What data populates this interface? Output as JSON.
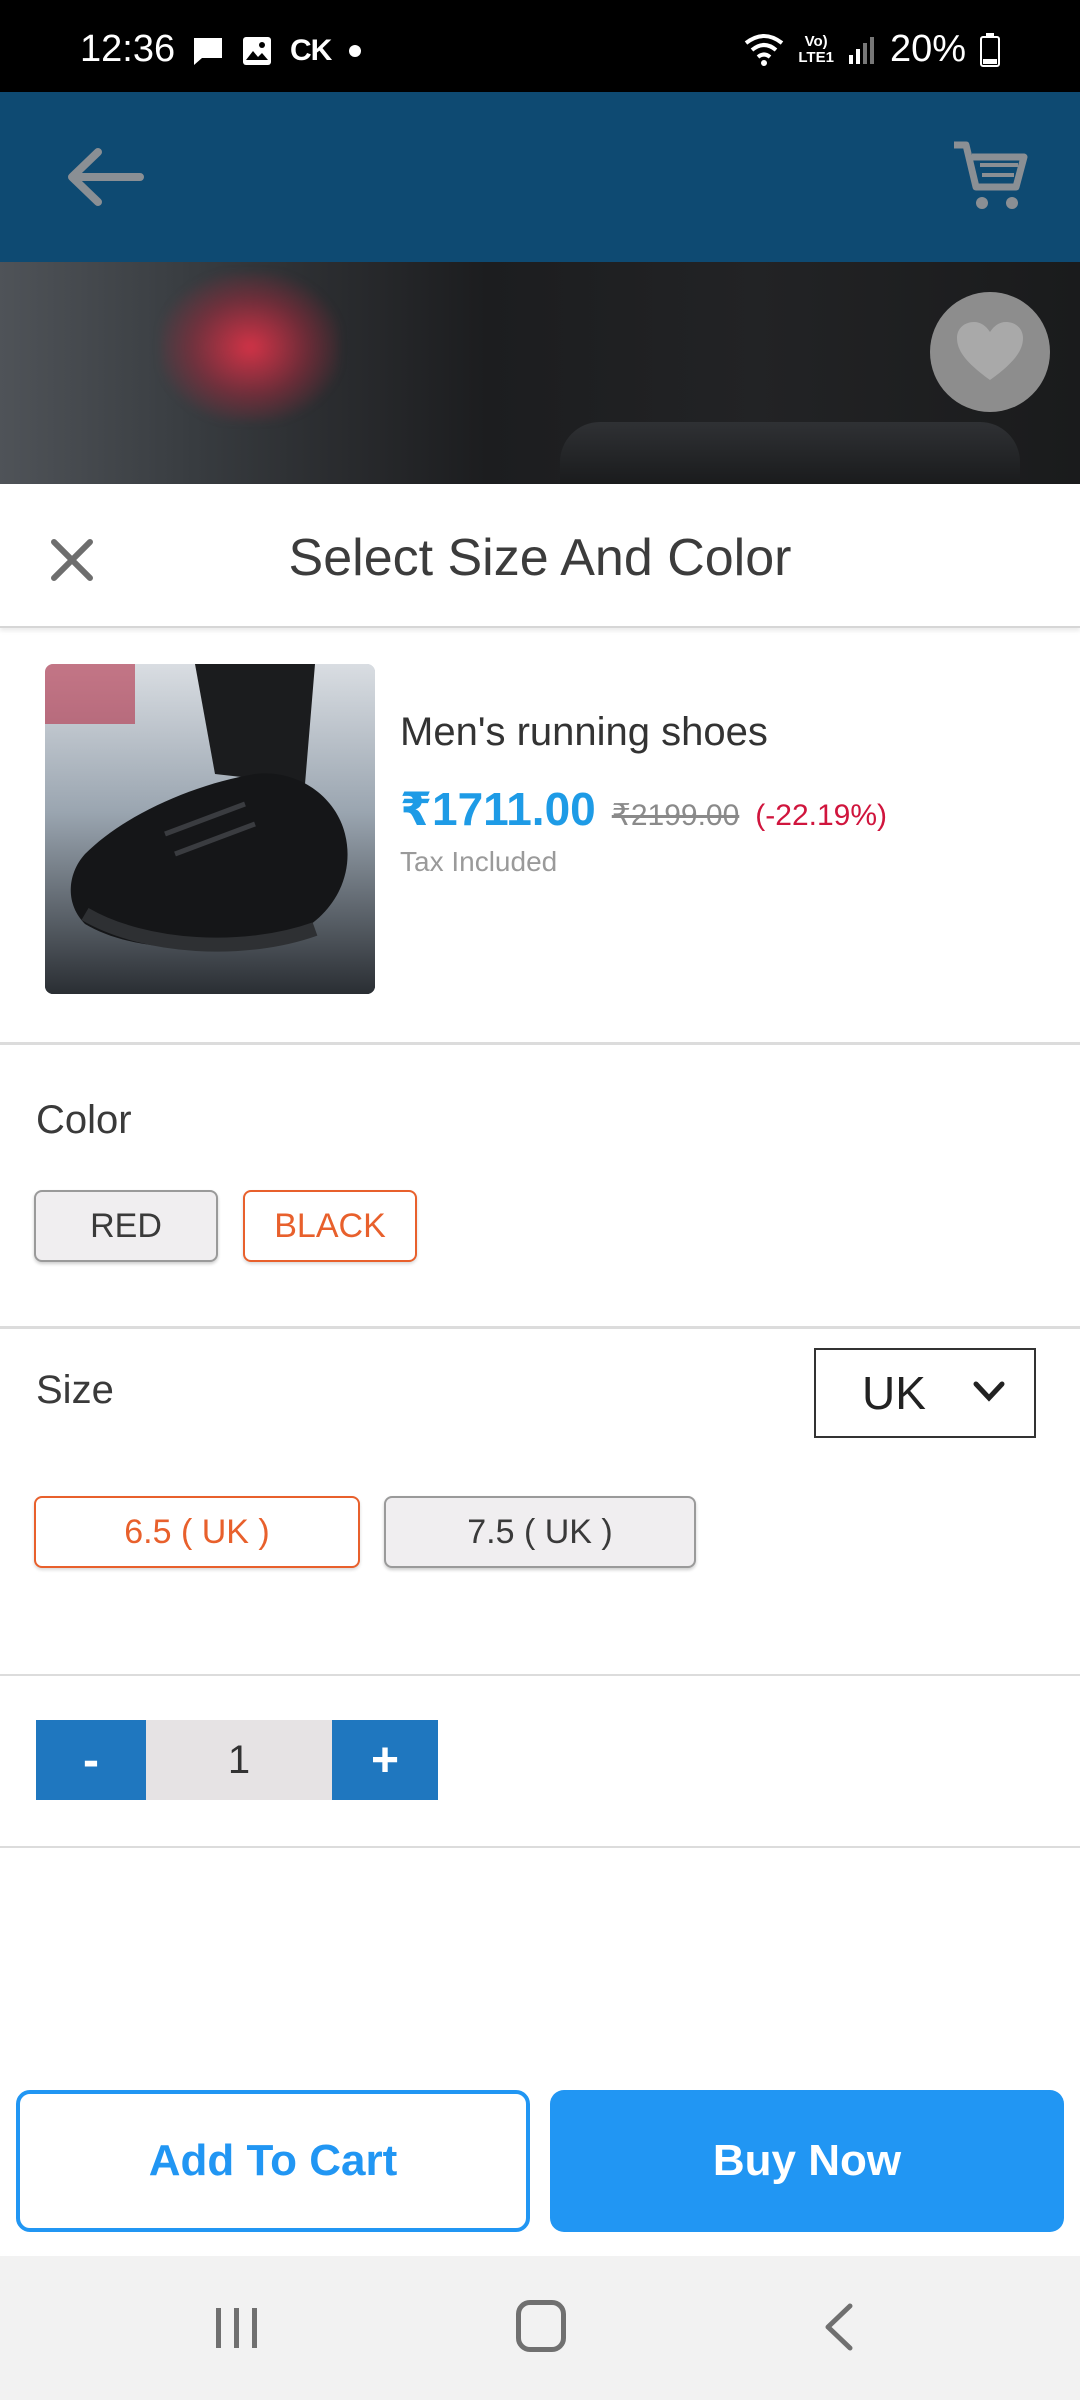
{
  "status_bar": {
    "time": "12:36",
    "carrier_tag": "CK",
    "network_label_top": "Vo)",
    "network_label_bottom": "LTE1",
    "battery": "20%"
  },
  "header": {
    "back_icon": "arrow-left-icon",
    "cart_icon": "shopping-cart-icon",
    "color": "#0e4a72"
  },
  "hero": {
    "favorite_icon": "heart-icon"
  },
  "sheet": {
    "title": "Select Size And Color",
    "close_icon": "close-icon",
    "product": {
      "name": "Men's running shoes",
      "price": "₹1711.00",
      "original_price": "₹2199.00",
      "discount": "(-22.19%)",
      "tax_note": "Tax Included"
    },
    "color_section": {
      "label": "Color",
      "options": [
        {
          "label": "RED",
          "selected": false
        },
        {
          "label": "BLACK",
          "selected": true
        }
      ]
    },
    "size_section": {
      "label": "Size",
      "unit_selected": "UK",
      "options": [
        {
          "label": "6.5 ( UK )",
          "selected": true
        },
        {
          "label": "7.5 ( UK )",
          "selected": false
        }
      ]
    },
    "quantity": {
      "decrement_label": "-",
      "value": "1",
      "increment_label": "+"
    },
    "actions": {
      "add_to_cart": "Add To Cart",
      "buy_now": "Buy Now"
    }
  },
  "colors": {
    "accent": "#2196f3",
    "selected_chip": "#e8602c",
    "discount": "#d0153d",
    "quantity_button": "#1f77bf"
  }
}
